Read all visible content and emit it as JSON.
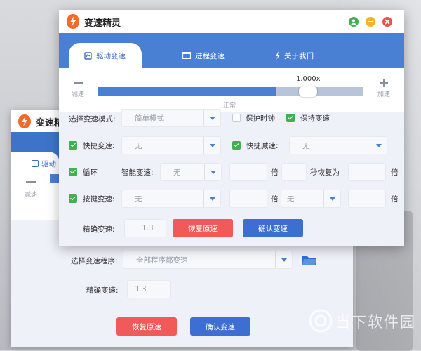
{
  "app": {
    "title": "变速精灵",
    "title_partial": "变速精",
    "accent": "#4a80d4",
    "controls": {
      "user": "user-icon",
      "minimize": "minimize-icon",
      "close": "close-icon"
    }
  },
  "tabs": [
    {
      "label": "驱动变速",
      "icon": "speed-icon",
      "active": true
    },
    {
      "label": "进程变速",
      "icon": "window-icon",
      "active": false
    },
    {
      "label": "关于我们",
      "icon": "info-icon",
      "active": false
    }
  ],
  "back_tab_label": "驱动",
  "slider": {
    "minus_label": "减速",
    "plus_label": "加速",
    "value_text": "1.000x",
    "center_label": "正常",
    "fill_fraction": 0.67,
    "thumb_fraction": 0.79
  },
  "form": {
    "mode_label": "选择变速模式:",
    "mode_value": "简单模式",
    "protect_clock_label": "保护时钟",
    "protect_clock_checked": false,
    "keep_speed_label": "保持变速",
    "keep_speed_checked": true,
    "quick_speedup_label": "快捷变速:",
    "quick_speedup_value": "无",
    "quick_speedup_checked": true,
    "quick_slowdown_label": "快捷减速:",
    "quick_slowdown_value": "无",
    "quick_slowdown_checked": true,
    "loop_label": "循环",
    "loop_checked": true,
    "smart_speed_label": "智能变速:",
    "smart_speed_value": "无",
    "times_unit": "倍",
    "seconds_restore_label": "秒恢复为",
    "hotkey_speed_label": "按键变速:",
    "hotkey_speed_value": "无",
    "hotkey_speed_checked": true,
    "hotkey_second_value": "无",
    "precise_label": "精确变速:",
    "precise_value": "1.3",
    "restore_button": "恢复原速",
    "confirm_button": "确认变速"
  },
  "back_form": {
    "program_label": "选择变速程序:",
    "program_value": "全部程序都变速",
    "precise_label": "精确变速:",
    "precise_value": "1.3",
    "restore_button": "恢复原速",
    "confirm_button": "确认变速"
  },
  "watermark": "当下软件园"
}
